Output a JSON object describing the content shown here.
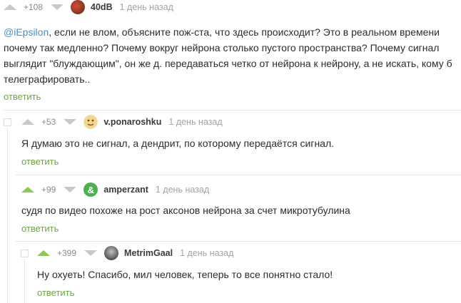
{
  "comments": [
    {
      "rating": "+108",
      "user": "40dB",
      "time": "1 день назад",
      "mention": "@iEpsilon",
      "text_lines": [
        ", если не влом, объясните пож-ста, что здесь происходит? Это в реальном времени",
        "почему так медленно? Почему вокруг нейрона столько пустого пространства? Почему сигнал",
        "выглядит \"блуждающим\", он же д. передаваться четко от нейрона к нейрону, а не искать, кому б",
        "телеграфировать.."
      ],
      "reply": "ответить"
    },
    {
      "rating": "+53",
      "user": "v.ponaroshku",
      "time": "1 день назад",
      "text": "Я думаю это не сигнал, а дендрит, по которому передаётся сигнал.",
      "reply": "ответить"
    },
    {
      "rating": "+99",
      "user": "amperzant",
      "time": "1 день назад",
      "text": "судя по видео похоже на рост аксонов нейрона за счет микротубулина",
      "reply": "ответить"
    },
    {
      "rating": "+399",
      "user": "MetrimGaal",
      "time": "1 день назад",
      "text": "Ну охуеть! Спасибо, мил человек, теперь то все понятно стало!",
      "reply": "ответить"
    }
  ],
  "colors": {
    "accent_green": "#8ac858",
    "reply_green": "#71a248",
    "mention_blue": "#4c8ec4",
    "vote_grey": "#c8c8c8"
  },
  "icons": [
    "arrow-up-icon",
    "arrow-down-icon",
    "collapse-icon"
  ]
}
